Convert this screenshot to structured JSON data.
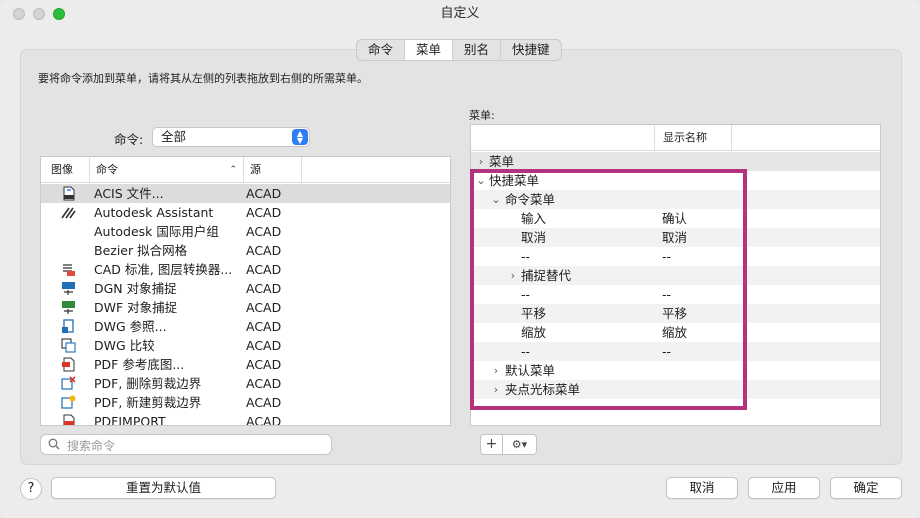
{
  "window": {
    "title": "自定义"
  },
  "tabs": [
    {
      "label": "命令"
    },
    {
      "label": "菜单"
    },
    {
      "label": "别名"
    },
    {
      "label": "快捷键"
    }
  ],
  "instructions": "要将命令添加到菜单，请将其从左侧的列表拖放到右侧的所需菜单。",
  "command_filter": {
    "label": "命令:",
    "value": "全部"
  },
  "command_list": {
    "headers": {
      "image": "图像",
      "command": "命令",
      "source": "源"
    },
    "rows": [
      {
        "icon": "acis-file-icon",
        "name": "ACIS 文件...",
        "source": "ACAD"
      },
      {
        "icon": "autodesk-assistant-icon",
        "name": "Autodesk Assistant",
        "source": "ACAD"
      },
      {
        "icon": "",
        "name": "Autodesk 国际用户组",
        "source": "ACAD"
      },
      {
        "icon": "",
        "name": "Bezier 拟合网格",
        "source": "ACAD"
      },
      {
        "icon": "cad-standards-icon",
        "name": "CAD 标准, 图层转换器...",
        "source": "ACAD"
      },
      {
        "icon": "dgn-snap-icon",
        "name": "DGN 对象捕捉",
        "source": "ACAD"
      },
      {
        "icon": "dwf-snap-icon",
        "name": "DWF 对象捕捉",
        "source": "ACAD"
      },
      {
        "icon": "dwg-reference-icon",
        "name": "DWG 参照...",
        "source": "ACAD"
      },
      {
        "icon": "dwg-compare-icon",
        "name": "DWG 比较",
        "source": "ACAD"
      },
      {
        "icon": "pdf-underlay-icon",
        "name": "PDF 参考底图...",
        "source": "ACAD"
      },
      {
        "icon": "pdf-delete-clip-icon",
        "name": "PDF, 删除剪裁边界",
        "source": "ACAD"
      },
      {
        "icon": "pdf-new-clip-icon",
        "name": "PDF, 新建剪裁边界",
        "source": "ACAD"
      },
      {
        "icon": "pdfimport-icon",
        "name": "PDFIMPORT",
        "source": "ACAD"
      }
    ]
  },
  "search": {
    "placeholder": "搜索命令"
  },
  "menu_tree": {
    "label": "菜单:",
    "display_name_header": "显示名称",
    "rows": [
      {
        "name": "菜单",
        "display": "",
        "chevron": "collapsed"
      },
      {
        "name": "快捷菜单",
        "display": "",
        "chevron": "expanded"
      },
      {
        "name": "命令菜单",
        "display": "",
        "chevron": "expanded"
      },
      {
        "name": "输入",
        "display": "确认",
        "chevron": ""
      },
      {
        "name": "取消",
        "display": "取消",
        "chevron": ""
      },
      {
        "name": "--",
        "display": "--",
        "chevron": ""
      },
      {
        "name": "捕捉替代",
        "display": "",
        "chevron": "collapsed"
      },
      {
        "name": "--",
        "display": "--",
        "chevron": ""
      },
      {
        "name": "平移",
        "display": "平移",
        "chevron": ""
      },
      {
        "name": "缩放",
        "display": "缩放",
        "chevron": ""
      },
      {
        "name": "--",
        "display": "--",
        "chevron": ""
      },
      {
        "name": "默认菜单",
        "display": "",
        "chevron": "collapsed"
      },
      {
        "name": "夹点光标菜单",
        "display": "",
        "chevron": "collapsed"
      }
    ]
  },
  "tree_buttons": {
    "add": "+",
    "gear": "⚙︎▾"
  },
  "buttons": {
    "help": "?",
    "reset": "重置为默认值",
    "cancel": "取消",
    "apply": "应用",
    "ok": "确定"
  },
  "colors": {
    "highlight": "#b5337d",
    "accent": "#2f7df6",
    "close_inactive": "#d3d3d3",
    "zoom": "#2ebd3a"
  }
}
